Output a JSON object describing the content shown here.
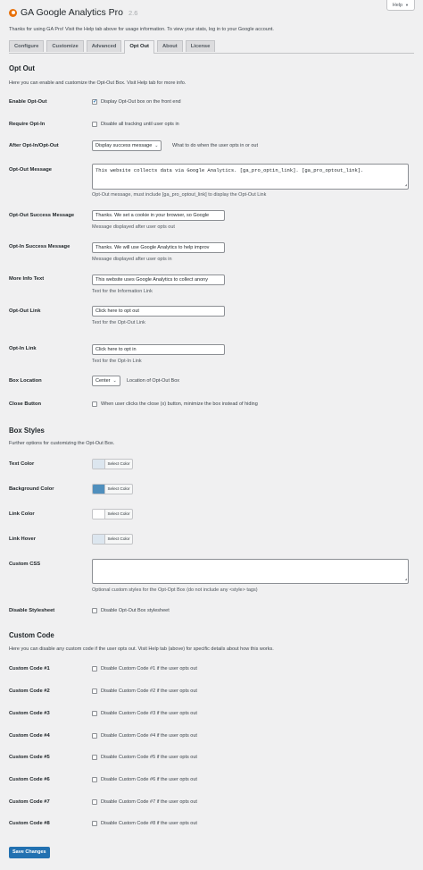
{
  "help_label": "Help",
  "header": {
    "title": "GA Google Analytics Pro",
    "version": "2.6"
  },
  "intro": "Thanks for using GA Pro! Visit the Help tab above for usage information. To view your stats, log in to your Google account.",
  "tabs": [
    "Configure",
    "Customize",
    "Advanced",
    "Opt Out",
    "About",
    "License"
  ],
  "active_tab": "Opt Out",
  "optout": {
    "title": "Opt Out",
    "desc": "Here you can enable and customize the Opt-Out Box. Visit Help tab for more info.",
    "enable": {
      "label": "Enable Opt-Out",
      "option": "Display Opt-Out box on the front end",
      "checked": true
    },
    "require": {
      "label": "Require Opt-In",
      "option": "Disable all tracking until user opts in",
      "checked": false
    },
    "after": {
      "label": "After Opt-In/Opt-Out",
      "selected": "Display success message",
      "desc": "What to do when the user opts in or out"
    },
    "message": {
      "label": "Opt-Out Message",
      "value": "This website collects data via Google Analytics. [ga_pro_optin_link]. [ga_pro_optout_link].",
      "desc": "Opt-Out message, must include [ga_pro_optout_link] to display the Opt-Out Link"
    },
    "success_out": {
      "label": "Opt-Out Success Message",
      "value": "Thanks. We set a cookie in your browser, so Google",
      "desc": "Message displayed after user opts out"
    },
    "success_in": {
      "label": "Opt-In Success Message",
      "value": "Thanks. We will use Google Analytics to help improv",
      "desc": "Message displayed after user opts in"
    },
    "more_info": {
      "label": "More Info Text",
      "value": "This website uses Google Analytics to collect anony",
      "desc": "Text for the Information Link"
    },
    "optout_link": {
      "label": "Opt-Out Link",
      "value": "Click here to opt out",
      "desc": "Text for the Opt-Out Link"
    },
    "optin_link": {
      "label": "Opt-In Link",
      "value": "Click here to opt in",
      "desc": "Text for the Opt-In Link"
    },
    "location": {
      "label": "Box Location",
      "selected": "Center",
      "desc": "Location of Opt-Out Box"
    },
    "close": {
      "label": "Close Button",
      "option": "When user clicks the close (x) button, minimize the box instead of hiding",
      "checked": false
    }
  },
  "styles": {
    "title": "Box Styles",
    "desc": "Further options for customizing the Opt-Out Box.",
    "button_label": "Select Color",
    "text_color": {
      "label": "Text Color",
      "color": "#dce6ef"
    },
    "bg_color": {
      "label": "Background Color",
      "color": "#4f8fbd"
    },
    "link_color": {
      "label": "Link Color",
      "color": "#ffffff"
    },
    "link_hover": {
      "label": "Link Hover",
      "color": "#dce6ef"
    },
    "custom_css": {
      "label": "Custom CSS",
      "value": "",
      "desc": "Optional custom styles for the Opt-Opt Box (do not include any <style> tags)"
    },
    "disable": {
      "label": "Disable Stylesheet",
      "option": "Disable Opt-Out Box stylesheet",
      "checked": false
    }
  },
  "custom_code": {
    "title": "Custom Code",
    "desc": "Here you can disable any custom code if the user opts out. Visit Help tab (above) for specific details about how this works.",
    "items": [
      {
        "label": "Custom Code #1",
        "option": "Disable Custom Code #1 if the user opts out"
      },
      {
        "label": "Custom Code #2",
        "option": "Disable Custom Code #2 if the user opts out"
      },
      {
        "label": "Custom Code #3",
        "option": "Disable Custom Code #3 if the user opts out"
      },
      {
        "label": "Custom Code #4",
        "option": "Disable Custom Code #4 if the user opts out"
      },
      {
        "label": "Custom Code #5",
        "option": "Disable Custom Code #5 if the user opts out"
      },
      {
        "label": "Custom Code #6",
        "option": "Disable Custom Code #6 if the user opts out"
      },
      {
        "label": "Custom Code #7",
        "option": "Disable Custom Code #7 if the user opts out"
      },
      {
        "label": "Custom Code #8",
        "option": "Disable Custom Code #8 if the user opts out"
      }
    ]
  },
  "save_label": "Save Changes"
}
